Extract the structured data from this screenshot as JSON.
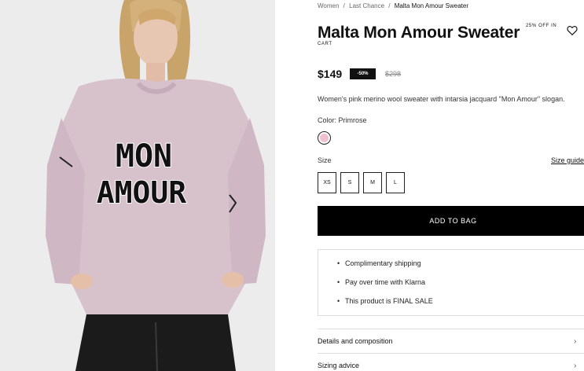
{
  "breadcrumb": {
    "items": [
      "Women",
      "Last Chance",
      "Malta Mon Amour Sweater"
    ],
    "separator": "/"
  },
  "product": {
    "title": "Malta Mon Amour Sweater",
    "promo_text": "25% OFF IN",
    "promo_text_cont": "CART",
    "price": "$149",
    "discount_badge": "-50%",
    "original_price": "$298",
    "description": "Women's pink merino wool sweater with intarsia jacquard \"Mon Amour\" slogan.",
    "color_label": "Color: Primrose",
    "color_swatch": "#f2bfd0",
    "size_label": "Size",
    "size_guide_label": "Size guide",
    "sizes": [
      "XS",
      "S",
      "M",
      "L"
    ],
    "add_to_bag_label": "ADD TO BAG",
    "wishlist_icon": "heart-icon"
  },
  "perks": [
    "Complimentary shipping",
    "Pay over time with Klarna",
    "This product is FINAL SALE"
  ],
  "accordions": [
    {
      "label": "Details and composition",
      "icon": "chevron-right-icon"
    },
    {
      "label": "Sizing advice",
      "icon": "chevron-right-icon"
    }
  ],
  "image": {
    "sweater_text_line1": "MON",
    "sweater_text_line2": "AMOUR"
  },
  "colors": {
    "button_bg": "#000000",
    "badge_bg": "#111111",
    "border": "#dddddd"
  }
}
